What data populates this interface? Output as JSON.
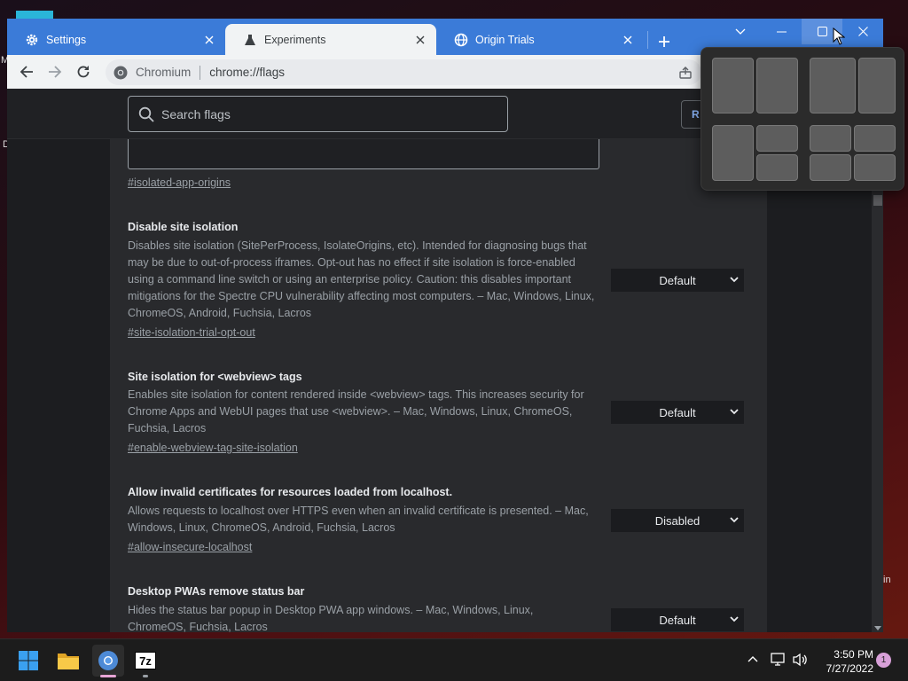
{
  "desktop": {
    "side_letters": [
      "M",
      "D",
      "in"
    ]
  },
  "tabs": [
    {
      "label": "Settings",
      "icon": "gear-icon"
    },
    {
      "label": "Experiments",
      "icon": "flask-icon"
    },
    {
      "label": "Origin Trials",
      "icon": "globe-icon"
    }
  ],
  "omnibox": {
    "brand": "Chromium",
    "url": "chrome://flags"
  },
  "flags_page": {
    "search_placeholder": "Search flags",
    "reset_label": "R",
    "partial_link": "#isolated-app-origins",
    "flags": [
      {
        "title": "Disable site isolation",
        "description": "Disables site isolation (SitePerProcess, IsolateOrigins, etc). Intended for diagnosing bugs that may be due to out-of-process iframes. Opt-out has no effect if site isolation is force-enabled using a command line switch or using an enterprise policy. Caution: this disables important mitigations for the Spectre CPU vulnerability affecting most computers. – Mac, Windows, Linux, ChromeOS, Android, Fuchsia, Lacros",
        "link": "#site-isolation-trial-opt-out",
        "value": "Default"
      },
      {
        "title": "Site isolation for <webview> tags",
        "description": "Enables site isolation for content rendered inside <webview> tags. This increases security for Chrome Apps and WebUI pages that use <webview>. – Mac, Windows, Linux, ChromeOS, Fuchsia, Lacros",
        "link": "#enable-webview-tag-site-isolation",
        "value": "Default"
      },
      {
        "title": "Allow invalid certificates for resources loaded from localhost.",
        "description": "Allows requests to localhost over HTTPS even when an invalid certificate is presented. – Mac, Windows, Linux, ChromeOS, Android, Fuchsia, Lacros",
        "link": "#allow-insecure-localhost",
        "value": "Disabled"
      },
      {
        "title": "Desktop PWAs remove status bar",
        "description": "Hides the status bar popup in Desktop PWA app windows. – Mac, Windows, Linux, ChromeOS, Fuchsia, Lacros",
        "link": "",
        "value": "Default"
      }
    ]
  },
  "taskbar": {
    "apps": [
      "windows-start-icon",
      "file-explorer-icon",
      "chromium-icon",
      "7zip-icon"
    ],
    "sevenzip_label": "7z",
    "time": "3:50 PM",
    "date": "7/27/2022",
    "notification_count": "1"
  },
  "colors": {
    "tabstrip": "#3b7bd8",
    "page_bg": "#202124",
    "link": "#9aa0a6",
    "accent": "#8ab4f8"
  }
}
